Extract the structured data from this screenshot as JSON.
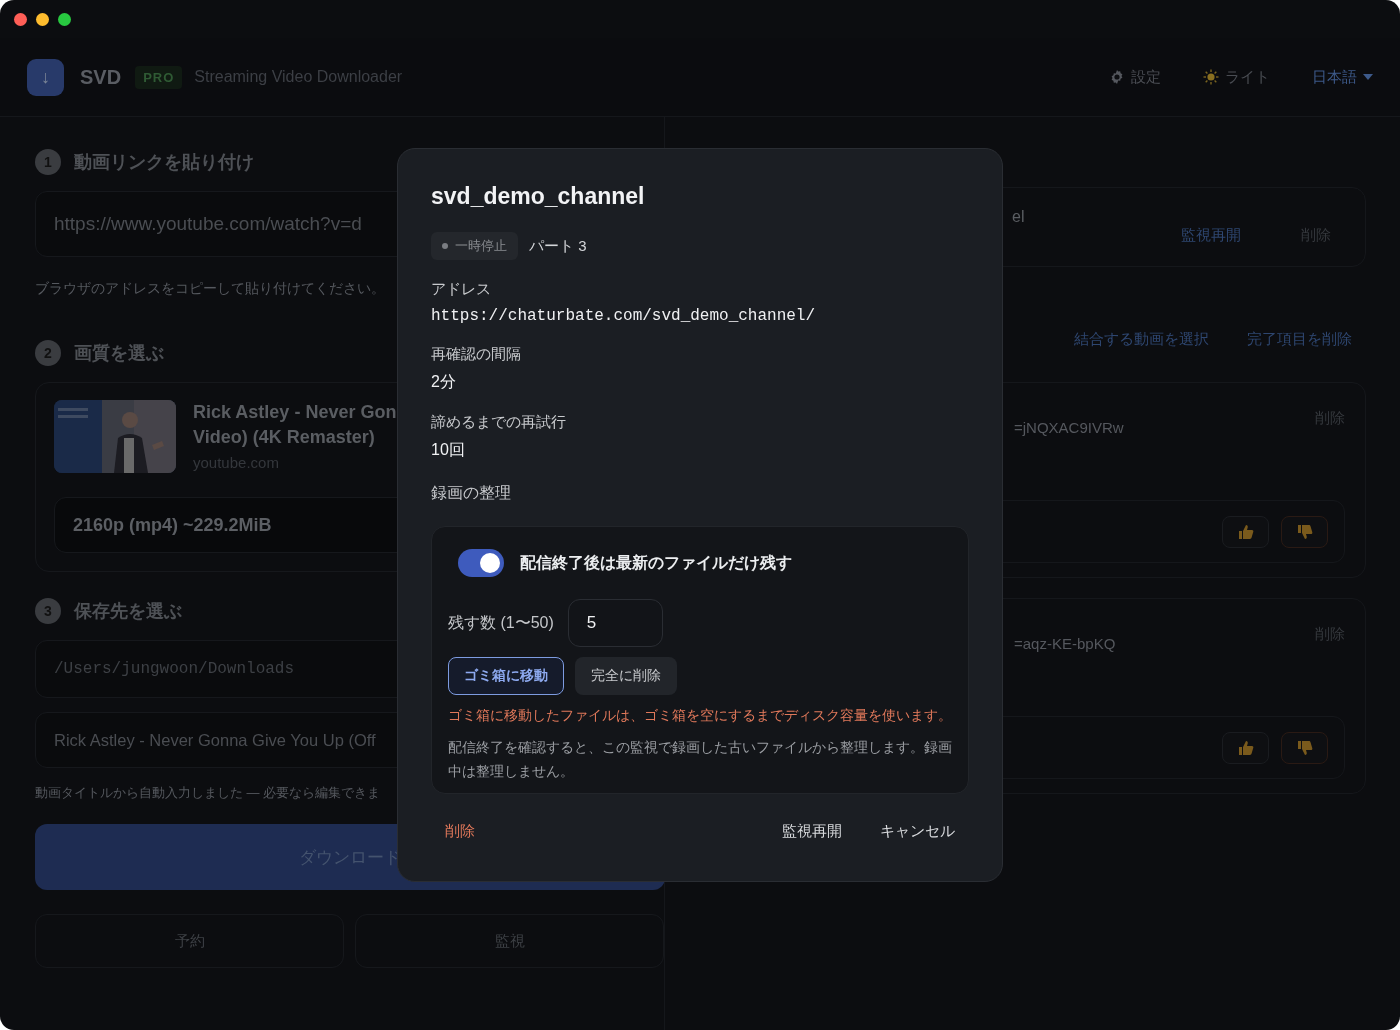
{
  "window": {
    "traffic_lights": [
      {
        "color": "#ff5f57"
      },
      {
        "color": "#febc2e"
      },
      {
        "color": "#28c840"
      }
    ]
  },
  "header": {
    "logo": "↓",
    "app_name": "SVD",
    "badge": "PRO",
    "subtitle": "Streaming Video Downloader",
    "actions": [
      {
        "kind": "settings",
        "label": "設定"
      },
      {
        "kind": "theme",
        "label": "ライト"
      },
      {
        "kind": "language",
        "label": "日本語"
      }
    ]
  },
  "steps": [
    {
      "number": "1",
      "title": "動画リンクを貼り付け",
      "kind": "link",
      "field_value": "https://www.youtube.com/watch?v=d",
      "hint": "ブラウザのアドレスをコピーして貼り付けてください。"
    },
    {
      "number": "2",
      "title": "画質を選ぶ",
      "kind": "quality",
      "video_title_lines": [
        "Rick Astley - Never Gon",
        "Video) (4K Remaster)"
      ],
      "source": "youtube.com",
      "format": "2160p (mp4) ~229.2MiB"
    },
    {
      "number": "3",
      "title": "保存先を選ぶ",
      "kind": "destination",
      "path": "/Users/jungwoon/Downloads",
      "filename": "Rick Astley - Never Gonna Give You Up (Off",
      "hint": "動画タイトルから自動入力しました — 必要なら編集できま"
    }
  ],
  "download_button": "ダウンロード",
  "secondary_buttons": [
    "予約",
    "監視"
  ],
  "monitor_card": {
    "title_fragment": "el",
    "actions": [
      "監視再開",
      "削除"
    ]
  },
  "queue_actions": [
    "結合する動画を選択",
    "完了項目を削除"
  ],
  "queue_items": [
    {
      "url_fragment": "=jNQXAC9IVRw",
      "delete": "削除"
    },
    {
      "url_fragment": "=aqz-KE-bpKQ",
      "delete": "削除"
    }
  ],
  "modal": {
    "title": "svd_demo_channel",
    "status": "一時停止",
    "part": "パート 3",
    "fields": [
      {
        "label": "アドレス",
        "value": "https://chaturbate.com/svd_demo_channel/",
        "kind": "mono"
      },
      {
        "label": "再確認の間隔",
        "value": "2分",
        "kind": "text"
      },
      {
        "label": "諦めるまでの再試行",
        "value": "10回",
        "kind": "text"
      }
    ],
    "section_title": "録画の整理",
    "cleanup": {
      "toggle_label": "配信終了後は最新のファイルだけ残す",
      "on": true,
      "keep_label": "残す数 (1〜50)",
      "keep_value": "5",
      "modes": [
        {
          "label": "ゴミ箱に移動",
          "selected": true
        },
        {
          "label": "完全に削除",
          "selected": false
        }
      ],
      "warning": "ゴミ箱に移動したファイルは、ゴミ箱を空にするまでディスク容量を使います。",
      "note": "配信終了を確認すると、この監視で録画した古いファイルから整理します。録画中は整理しません。"
    },
    "delete_button": "削除",
    "actions": [
      "監視再開",
      "キャンセル"
    ]
  }
}
